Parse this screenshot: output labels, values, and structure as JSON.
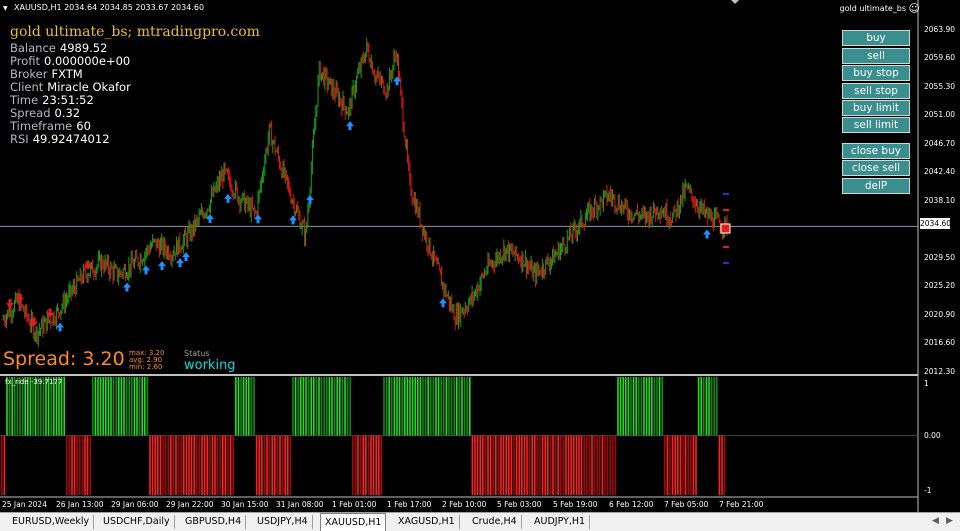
{
  "symbol_line": "XAUUSD,H1  2034.64 2034.85 2033.67 2034.60",
  "ea_title": "gold ultimate_bs; mtradingpro.com",
  "ea_name_corner": "gold ultimate_bs",
  "smile_glyph": "☺",
  "info": [
    {
      "k": "Balance",
      "v": "4989.52"
    },
    {
      "k": "Profit",
      "v": "0.000000e+00"
    },
    {
      "k": "Broker",
      "v": "FXTM"
    },
    {
      "k": "Client",
      "v": "Miracle Okafor"
    },
    {
      "k": "Time",
      "v": "23:51:52"
    },
    {
      "k": "Spread",
      "v": "0.32"
    },
    {
      "k": "Timeframe",
      "v": "60"
    },
    {
      "k": "RSI",
      "v": "49.92474012"
    }
  ],
  "spread_panel": {
    "big": "Spread: 3.20",
    "max": "max: 3.20",
    "avg": "avg: 2.90",
    "min": "min: 2.60"
  },
  "status": {
    "label": "Status",
    "value": "working"
  },
  "buttons": {
    "buy": "buy",
    "sell": "sell",
    "buy_stop": "buy stop",
    "sell_stop": "sell stop",
    "buy_limit": "buy limit",
    "sell_limit": "sell limit",
    "close_buy": "close buy",
    "close_sell": "close sell",
    "delp": "delP"
  },
  "price_axis": [
    "2063.90",
    "2059.60",
    "2055.30",
    "2051.00",
    "2046.70",
    "2042.40",
    "2038.10",
    "2029.50",
    "2025.20",
    "2020.90",
    "2016.60",
    "2012.30"
  ],
  "current_price": "2034.60",
  "indicator": {
    "label": "fx_ride -39.7177",
    "axis_mid": "0.00",
    "axis_top": "1",
    "axis_bottom": "-1"
  },
  "date_axis": [
    "25 Jan 2024",
    "26 Jan 13:00",
    "29 Jan 06:00",
    "29 Jan 22:00",
    "30 Jan 15:00",
    "31 Jan 08:00",
    "1 Feb 01:00",
    "1 Feb 17:00",
    "2 Feb 10:00",
    "5 Feb 03:00",
    "5 Feb 19:00",
    "6 Feb 12:00",
    "7 Feb 05:00",
    "7 Feb 21:00"
  ],
  "tabs": [
    "EURUSD,Weekly",
    "USDCHF,Daily",
    "GBPUSD,H4",
    "USDJPY,H4",
    "XAUUSD,H1",
    "XAGUSD,H1",
    "Crude,H4",
    "AUDJPY,H1"
  ],
  "active_tab": "XAUUSD,H1",
  "colors": {
    "bull": "#1aa01a",
    "bear": "#e01818",
    "up_arrow": "#1e90ff",
    "down_arrow": "#e02020",
    "button": "#3b8e8e",
    "title": "#f0c020"
  },
  "chart_data": {
    "type": "candlestick",
    "symbol": "XAUUSD,H1",
    "y_range": [
      2011.5,
      2067.5
    ],
    "price_line": 2034.6,
    "close_path_anchors": [
      [
        0,
        2020.0
      ],
      [
        14,
        2023.0
      ],
      [
        30,
        2018.0
      ],
      [
        48,
        2021.0
      ],
      [
        60,
        2024.0
      ],
      [
        72,
        2027.0
      ],
      [
        88,
        2029.0
      ],
      [
        102,
        2027.0
      ],
      [
        118,
        2029.0
      ],
      [
        134,
        2032.0
      ],
      [
        150,
        2030.5
      ],
      [
        166,
        2033.5
      ],
      [
        182,
        2038.0
      ],
      [
        196,
        2043.0
      ],
      [
        210,
        2039.0
      ],
      [
        224,
        2036.5
      ],
      [
        236,
        2049.5
      ],
      [
        250,
        2042.0
      ],
      [
        268,
        2033.0
      ],
      [
        280,
        2059.0
      ],
      [
        296,
        2055.0
      ],
      [
        306,
        2052.5
      ],
      [
        312,
        2057.0
      ],
      [
        322,
        2062.5
      ],
      [
        330,
        2058.0
      ],
      [
        340,
        2056.0
      ],
      [
        348,
        2062.0
      ],
      [
        360,
        2041.0
      ],
      [
        372,
        2034.0
      ],
      [
        388,
        2026.0
      ],
      [
        400,
        2020.5
      ],
      [
        414,
        2023.0
      ],
      [
        428,
        2028.0
      ],
      [
        444,
        2031.0
      ],
      [
        460,
        2029.5
      ],
      [
        470,
        2027.0
      ],
      [
        488,
        2030.0
      ],
      [
        506,
        2034.0
      ],
      [
        522,
        2037.5
      ],
      [
        536,
        2039.5
      ],
      [
        552,
        2037.0
      ],
      [
        568,
        2036.0
      ],
      [
        580,
        2037.5
      ],
      [
        592,
        2036.0
      ],
      [
        604,
        2040.5
      ],
      [
        620,
        2036.5
      ],
      [
        634,
        2035.0
      ],
      [
        640,
        2034.6
      ]
    ],
    "indicator_series": {
      "name": "fx_ride",
      "last": -39.7177,
      "range": [
        -1,
        1
      ]
    }
  }
}
